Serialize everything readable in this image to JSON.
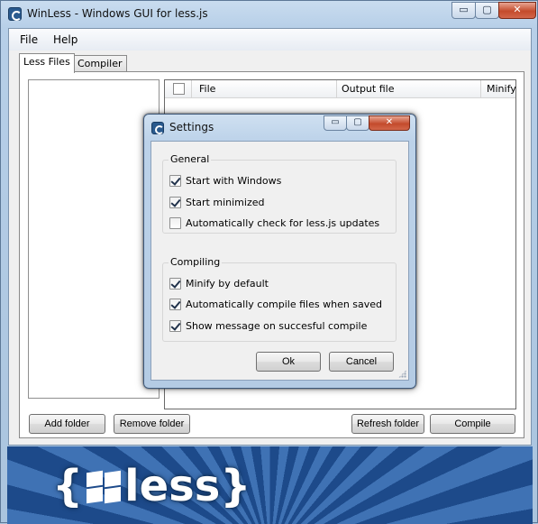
{
  "window": {
    "title": "WinLess - Windows GUI for less.js",
    "minimize_glyph": "▭",
    "maximize_glyph": "▢",
    "close_glyph": "✕"
  },
  "menu": {
    "file": "File",
    "help": "Help"
  },
  "tabs": {
    "less_files": "Less Files",
    "compiler": "Compiler"
  },
  "file_table": {
    "columns": [
      "File",
      "Output file",
      "Minify"
    ]
  },
  "buttons": {
    "add_folder": "Add folder",
    "remove_folder": "Remove folder",
    "refresh_folder": "Refresh folder",
    "compile": "Compile"
  },
  "banner": {
    "logo_left": "{",
    "logo_text": "less",
    "logo_right": "}"
  },
  "settings_dialog": {
    "title": "Settings",
    "general": {
      "label": "General",
      "options": [
        {
          "label": "Start with Windows",
          "checked": true
        },
        {
          "label": "Start minimized",
          "checked": true
        },
        {
          "label": "Automatically check for less.js updates",
          "checked": false
        }
      ]
    },
    "compiling": {
      "label": "Compiling",
      "options": [
        {
          "label": "Minify by default",
          "checked": true
        },
        {
          "label": "Automatically compile files when saved",
          "checked": true
        },
        {
          "label": "Show message on succesful compile",
          "checked": true
        }
      ]
    },
    "ok": "Ok",
    "cancel": "Cancel"
  },
  "colors": {
    "frame": "#b7cfe8",
    "close_button": "#c44b2c",
    "banner_dark": "#1d4a8a",
    "banner_light": "#3f72b4"
  }
}
